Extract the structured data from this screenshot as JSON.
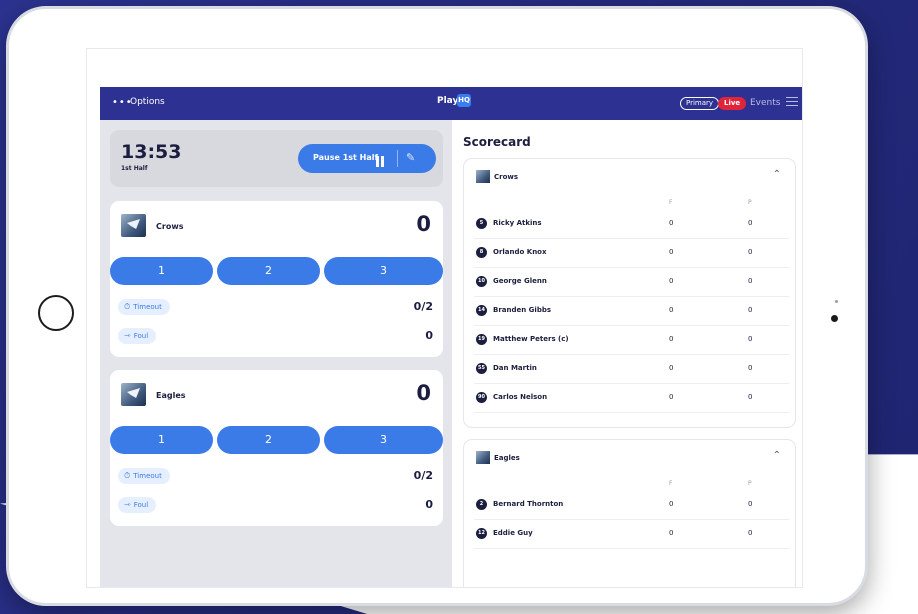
{
  "topbar": {
    "options_dots": "•••",
    "options_label": "Options",
    "brand": "Play",
    "brand_badge": "HQ",
    "primary_pill": "Primary",
    "live_pill": "Live",
    "events_label": "Events"
  },
  "clock": {
    "time": "13:53",
    "period": "1st Half",
    "pause_label": "Pause 1st Half"
  },
  "teams": [
    {
      "name": "Crows",
      "score": "0",
      "buttons": [
        "1",
        "2",
        "3"
      ],
      "timeout_label": "Timeout",
      "timeout_value": "0/2",
      "foul_label": "Foul",
      "foul_value": "0"
    },
    {
      "name": "Eagles",
      "score": "0",
      "buttons": [
        "1",
        "2",
        "3"
      ],
      "timeout_label": "Timeout",
      "timeout_value": "0/2",
      "foul_label": "Foul",
      "foul_value": "0"
    }
  ],
  "scorecard": {
    "title": "Scorecard",
    "col_f": "F",
    "col_p": "P",
    "crows": {
      "team": "Crows",
      "players": [
        {
          "num": "5",
          "name": "Ricky Atkins",
          "f": "0",
          "p": "0"
        },
        {
          "num": "8",
          "name": "Orlando Knox",
          "f": "0",
          "p": "0"
        },
        {
          "num": "10",
          "name": "George Glenn",
          "f": "0",
          "p": "0"
        },
        {
          "num": "14",
          "name": "Branden Gibbs",
          "f": "0",
          "p": "0"
        },
        {
          "num": "19",
          "name": "Matthew Peters (c)",
          "f": "0",
          "p": "0"
        },
        {
          "num": "55",
          "name": "Dan Martin",
          "f": "0",
          "p": "0"
        },
        {
          "num": "90",
          "name": "Carlos Nelson",
          "f": "0",
          "p": "0"
        }
      ]
    },
    "eagles": {
      "team": "Eagles",
      "players": [
        {
          "num": "2",
          "name": "Bernard Thornton",
          "f": "0",
          "p": "0"
        },
        {
          "num": "12",
          "name": "Eddie Guy",
          "f": "0",
          "p": "0"
        }
      ]
    }
  }
}
